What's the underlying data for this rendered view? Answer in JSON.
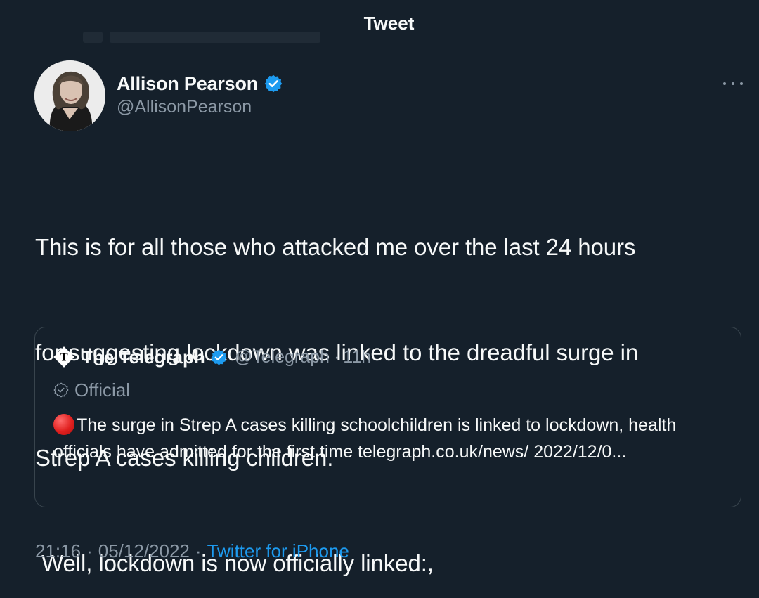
{
  "header": {
    "title": "Tweet"
  },
  "author": {
    "display_name": "Allison Pearson",
    "handle": "@AllisonPearson",
    "verified": true,
    "avatar_icon": "profile-photo"
  },
  "tweet": {
    "text_lines": [
      "This is for all those who attacked me over the last 24 hours",
      "for suggesting lockdown was linked to the dreadful surge in",
      "Strep A cases killing children.",
      " Well, lockdown is now officially linked:,"
    ]
  },
  "quoted_tweet": {
    "logo_icon": "telegraph-logo-icon",
    "display_name": "The Telegraph",
    "verified": true,
    "handle": "@Telegraph",
    "separator": "·",
    "time": "11h",
    "official_label": "Official",
    "text": "The surge in Strep A cases killing schoolchildren is linked to lockdown, health officials have admitted for the first time telegraph.co.uk/news/ 2022/12/0..."
  },
  "meta": {
    "time": "21:16",
    "separator": "·",
    "date": "05/12/2022",
    "source": "Twitter for iPhone"
  },
  "colors": {
    "background": "#15202b",
    "text_primary": "#f7f9f9",
    "text_secondary": "#8b98a5",
    "accent": "#1d9bf0",
    "border": "#38444d",
    "red_emoji": "#e0201f"
  }
}
